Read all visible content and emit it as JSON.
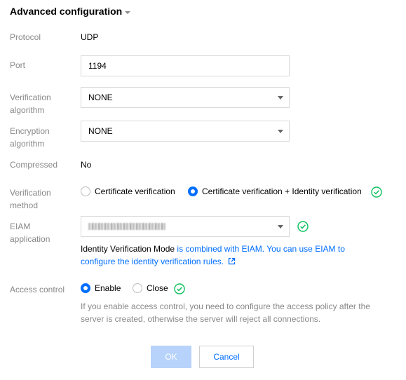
{
  "section": {
    "title": "Advanced configuration"
  },
  "protocol": {
    "label": "Protocol",
    "value": "UDP"
  },
  "port": {
    "label": "Port",
    "value": "1194"
  },
  "verification_algorithm": {
    "label_line1": "Verification",
    "label_line2": "algorithm",
    "value": "NONE"
  },
  "encryption_algorithm": {
    "label_line1": "Encryption",
    "label_line2": "algorithm",
    "value": "NONE"
  },
  "compressed": {
    "label": "Compressed",
    "value": "No"
  },
  "verification_method": {
    "label_line1": "Verification",
    "label_line2": "method",
    "options": [
      "Certificate verification",
      "Certificate verification + Identity verification"
    ],
    "selected": "Certificate verification + Identity verification"
  },
  "eiam": {
    "label_line1": "EIAM",
    "label_line2": "application",
    "help_prefix": "Identity Verification Mode",
    "help_link_line1": " is combined with EIAM. You can use EIAM to",
    "help_link_line2": "configure the identity verification rules."
  },
  "access_control": {
    "label": "Access control",
    "options": [
      "Enable",
      "Close"
    ],
    "selected": "Enable",
    "note_line1": "If you enable access control, you need to configure the access policy after the",
    "note_line2": "server is created, otherwise the server will reject all connections."
  },
  "buttons": {
    "ok": "OK",
    "cancel": "Cancel"
  },
  "colors": {
    "accent": "#006eff",
    "success": "#0abf5b",
    "ok_disabled": "#b7d3fb",
    "label": "#888888"
  }
}
